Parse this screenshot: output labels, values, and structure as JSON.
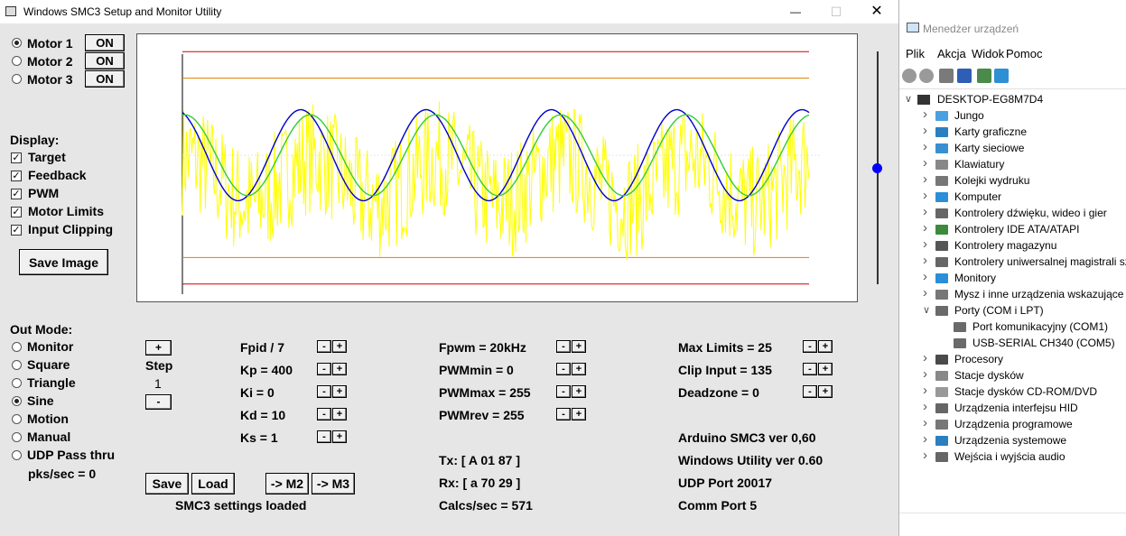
{
  "smc_window": {
    "title": "Windows SMC3 Setup and Monitor Utility",
    "controls": {
      "minimize": "—",
      "maximize": "☐",
      "close": "✕"
    },
    "motors": [
      {
        "label": "Motor 1",
        "selected": true,
        "button": "ON"
      },
      {
        "label": "Motor 2",
        "selected": false,
        "button": "ON"
      },
      {
        "label": "Motor 3",
        "selected": false,
        "button": "ON"
      }
    ],
    "display": {
      "heading": "Display:",
      "items": [
        {
          "label": "Target",
          "checked": true
        },
        {
          "label": "Feedback",
          "checked": true
        },
        {
          "label": "PWM",
          "checked": true
        },
        {
          "label": "Motor Limits",
          "checked": true
        },
        {
          "label": "Input Clipping",
          "checked": true
        }
      ],
      "save_image": "Save Image"
    },
    "out_mode": {
      "heading": "Out Mode:",
      "items": [
        {
          "label": "Monitor",
          "selected": false
        },
        {
          "label": "Square",
          "selected": false
        },
        {
          "label": "Triangle",
          "selected": false
        },
        {
          "label": "Sine",
          "selected": true
        },
        {
          "label": "Motion",
          "selected": false
        },
        {
          "label": "Manual",
          "selected": false
        },
        {
          "label": "UDP Pass thru",
          "selected": false
        }
      ],
      "pks_per_sec": "pks/sec = 0"
    },
    "step": {
      "plus": "+",
      "label": "Step",
      "value": "1",
      "minus": "-"
    },
    "pid_params": [
      "Fpid / 7",
      "Kp = 400",
      "Ki = 0",
      "Kd = 10",
      "Ks = 1"
    ],
    "pwm_params": [
      "Fpwm = 20kHz",
      "PWMmin = 0",
      "PWMmax = 255",
      "PWMrev = 255"
    ],
    "limit_params": [
      "Max Limits = 25",
      "Clip Input = 135",
      "Deadzone = 0"
    ],
    "stepper": {
      "minus": "-",
      "plus": "+"
    },
    "comm": {
      "tx": "Tx: [ A 01 87 ]",
      "rx": "Rx: [ a 70 29 ]",
      "calcs": "Calcs/sec = 571"
    },
    "info": [
      "Arduino SMC3 ver 0,60",
      "Windows Utility ver 0.60",
      "UDP Port 20017",
      "Comm Port 5"
    ],
    "buttons": {
      "save": "Save",
      "load": "Load",
      "to_m2": "-> M2",
      "to_m3": "-> M3"
    },
    "status": "SMC3 settings loaded",
    "slider_level": 0.5,
    "colors": {
      "target": "#0000cc",
      "feedback": "#33cc33",
      "pwm": "#ffff00",
      "limit_inner": "#e08000",
      "limit_outer": "#cc0000",
      "slider_thumb": "#0000ff"
    }
  },
  "device_manager": {
    "title": "Menedżer urządzeń",
    "menu": [
      "Plik",
      "Akcja",
      "Widok",
      "Pomoc"
    ],
    "toolbar_icons": [
      "back-icon",
      "forward-icon",
      "properties-icon",
      "help-icon",
      "update-driver-icon",
      "monitor-icon"
    ],
    "root": "DESKTOP-EG8M7D4",
    "tree": [
      {
        "label": "Jungo",
        "icon": "usb-controller-icon",
        "expanded": false
      },
      {
        "label": "Karty graficzne",
        "icon": "display-adapter-icon",
        "expanded": false
      },
      {
        "label": "Karty sieciowe",
        "icon": "network-adapter-icon",
        "expanded": false
      },
      {
        "label": "Klawiatury",
        "icon": "keyboard-icon",
        "expanded": false
      },
      {
        "label": "Kolejki wydruku",
        "icon": "printer-icon",
        "expanded": false
      },
      {
        "label": "Komputer",
        "icon": "computer-icon",
        "expanded": false
      },
      {
        "label": "Kontrolery dźwięku, wideo i gier",
        "icon": "speaker-icon",
        "expanded": false
      },
      {
        "label": "Kontrolery IDE ATA/ATAPI",
        "icon": "ide-controller-icon",
        "expanded": false
      },
      {
        "label": "Kontrolery magazynu",
        "icon": "storage-controller-icon",
        "expanded": false
      },
      {
        "label": "Kontrolery uniwersalnej magistrali sz",
        "icon": "usb-icon",
        "expanded": false
      },
      {
        "label": "Monitory",
        "icon": "monitor-icon",
        "expanded": false
      },
      {
        "label": "Mysz i inne urządzenia wskazujące",
        "icon": "mouse-icon",
        "expanded": false
      },
      {
        "label": "Porty (COM i LPT)",
        "icon": "port-icon",
        "expanded": true
      },
      {
        "label": "Port komunikacyjny (COM1)",
        "icon": "port-icon",
        "child": true
      },
      {
        "label": "USB-SERIAL CH340 (COM5)",
        "icon": "port-icon",
        "child": true
      },
      {
        "label": "Procesory",
        "icon": "processor-icon",
        "expanded": false
      },
      {
        "label": "Stacje dysków",
        "icon": "disk-drive-icon",
        "expanded": false
      },
      {
        "label": "Stacje dysków CD-ROM/DVD",
        "icon": "cdrom-icon",
        "expanded": false
      },
      {
        "label": "Urządzenia interfejsu HID",
        "icon": "hid-icon",
        "expanded": false
      },
      {
        "label": "Urządzenia programowe",
        "icon": "software-device-icon",
        "expanded": false
      },
      {
        "label": "Urządzenia systemowe",
        "icon": "system-device-icon",
        "expanded": false
      },
      {
        "label": "Wejścia i wyjścia audio",
        "icon": "audio-io-icon",
        "expanded": false
      }
    ]
  },
  "chart_data": {
    "type": "line",
    "title": "",
    "xlabel": "",
    "ylabel": "",
    "ylim": [
      -1,
      1
    ],
    "xlim": [
      0,
      1
    ],
    "grid": false,
    "series": [
      {
        "role": "target",
        "shape": "sine",
        "cycles": 5,
        "amplitude": 0.36,
        "offset": 0.1,
        "phase_start": "peak"
      },
      {
        "role": "feedback",
        "shape": "sine",
        "cycles": 5,
        "amplitude": 0.32,
        "offset": 0.1,
        "phase_lag": 0.015
      },
      {
        "role": "pwm",
        "shape": "noisy",
        "center": -0.1,
        "spread": 0.45
      },
      {
        "role": "motor_limits_outer",
        "values": [
          0.92,
          -0.92
        ]
      },
      {
        "role": "input_clipping",
        "values": [
          0.71,
          -0.71
        ]
      }
    ]
  }
}
